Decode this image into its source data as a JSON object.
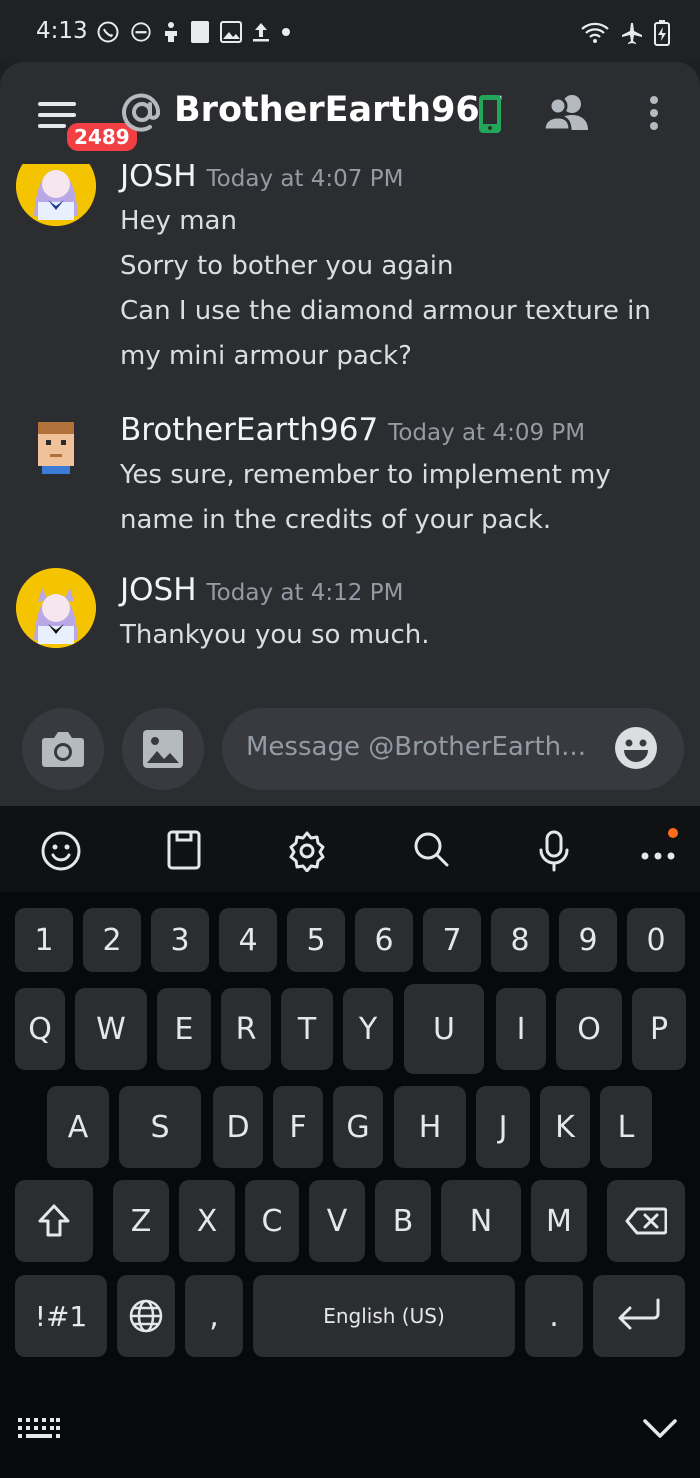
{
  "status": {
    "time": "4:13"
  },
  "header": {
    "badge": "2489",
    "title": "BrotherEarth967"
  },
  "messages": [
    {
      "author": "JOSH",
      "timestamp": "Today at 4:07 PM",
      "lines": [
        "Hey man",
        "Sorry to bother you again",
        "Can I use the diamond armour texture in",
        "my mini armour pack?"
      ]
    },
    {
      "author": "BrotherEarth967",
      "timestamp": "Today at 4:09 PM",
      "lines": [
        "Yes sure, remember to implement my",
        "name in the credits of your pack."
      ]
    },
    {
      "author": "JOSH",
      "timestamp": "Today at 4:12 PM",
      "lines": [
        "Thankyou you so much."
      ]
    }
  ],
  "composer": {
    "placeholder": "Message @BrotherEarth..."
  },
  "keyboard": {
    "row1": [
      "1",
      "2",
      "3",
      "4",
      "5",
      "6",
      "7",
      "8",
      "9",
      "0"
    ],
    "row2": [
      "Q",
      "W",
      "E",
      "R",
      "T",
      "Y",
      "U",
      "I",
      "O",
      "P"
    ],
    "row3": [
      "A",
      "S",
      "D",
      "F",
      "G",
      "H",
      "J",
      "K",
      "L"
    ],
    "row4": [
      "Z",
      "X",
      "C",
      "V",
      "B",
      "N",
      "M"
    ],
    "symbols": "!#1",
    "comma": ",",
    "space": "English (US)",
    "period": "."
  },
  "colors": {
    "accent_red": "#f23f43",
    "online_green": "#23a55a",
    "avatar_yellow": "#f5c400"
  }
}
